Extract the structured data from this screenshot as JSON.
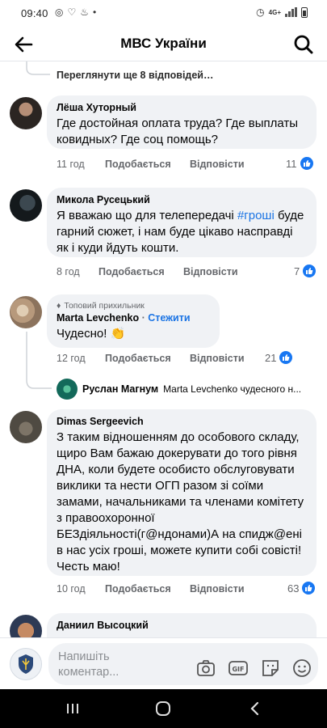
{
  "status_bar": {
    "time": "09:40",
    "network": "4G+"
  },
  "header": {
    "title": "МВС України"
  },
  "thread": {
    "more_replies": "Переглянути ще 8 відповідей…"
  },
  "comments": [
    {
      "author": "Лёша Хуторный",
      "text": "Где достойная оплата труда? Где выплаты ковидных? Где соц помощь?",
      "time": "11 год",
      "like_label": "Подобається",
      "reply_label": "Відповісти",
      "reactions": "11"
    },
    {
      "author": "Микола Русецький",
      "text_before": "Я вважаю що для телепередачі ",
      "hashtag": "#гроші",
      "text_after": " буде гарний сюжет, і нам буде цікаво насправді як і куди йдуть кошти.",
      "time": "8 год",
      "like_label": "Подобається",
      "reply_label": "Відповісти",
      "reactions": "7"
    },
    {
      "badge": "Топовий прихильник",
      "author": "Marta Levchenko",
      "follow_label": "Стежити",
      "text": "Чудесно! 👏",
      "time": "12 год",
      "like_label": "Подобається",
      "reply_label": "Відповісти",
      "reactions": "21"
    },
    {
      "author": "Dimas Sergeevich",
      "text": "З таким відношенням до особового складу,  щиро Вам бажаю докерувати до того рівня ДНА, коли будете особисто обслуговувати виклики та нести ОГП разом зі соїми замами, начальниками та членами комітету з правоохоронної БЕЗдіяльності(г@ндонами)А на спидж@ені в нас усіх гроші, можете купити собі совісті! Честь маю!",
      "time": "10 год",
      "like_label": "Подобається",
      "reply_label": "Відповісти",
      "reactions": "63"
    },
    {
      "author": "Даниил Высоцкий"
    }
  ],
  "reply_preview": {
    "author": "Руслан Магнум",
    "text": "Marta Levchenko чудесного н..."
  },
  "composer": {
    "placeholder": "Напишіть коментар..."
  },
  "colors": {
    "accent": "#1877f2",
    "bubble": "#f0f2f5",
    "meta": "#65676b"
  }
}
